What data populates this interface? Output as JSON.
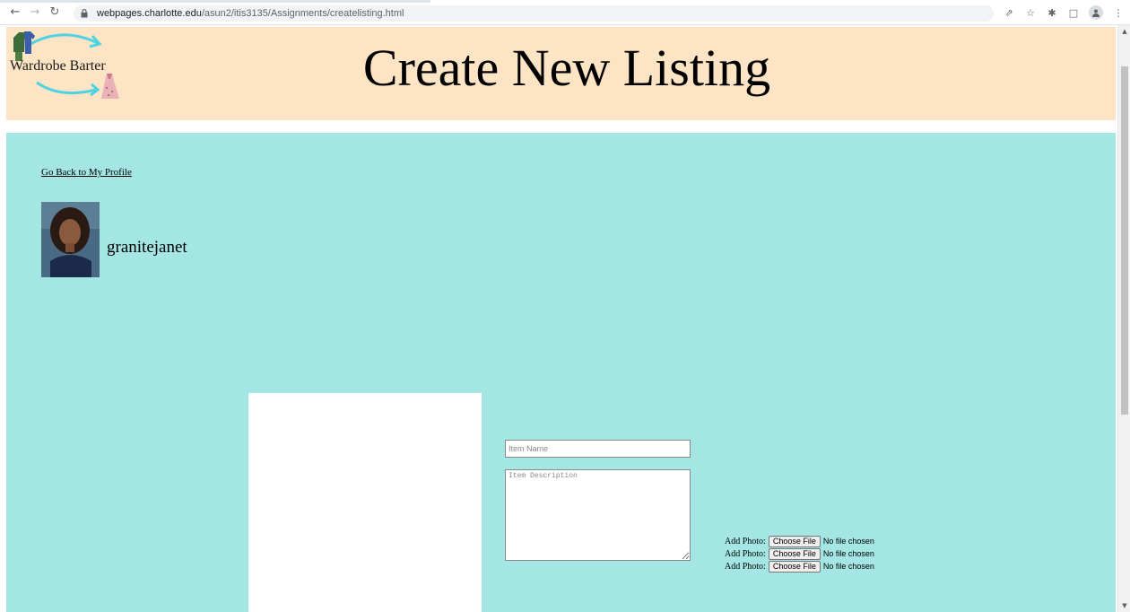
{
  "browser": {
    "url_host": "webpages.charlotte.edu",
    "url_path": "/asun2/itis3135/Assignments/createlisting.html",
    "icons": [
      "back-arrow-icon",
      "forward-arrow-icon",
      "reload-icon",
      "lock-icon",
      "share-icon",
      "star-icon",
      "extensions-icon",
      "side-panel-icon",
      "profile-icon",
      "more-icon"
    ]
  },
  "header": {
    "logo_text": "Wardrobe Barter",
    "title": "Create New Listing"
  },
  "profile": {
    "back_link": "Go Back to My Profile",
    "username": "granitejanet"
  },
  "form": {
    "item_name_placeholder": "Item Name",
    "item_description_placeholder": "Item Description",
    "photo_inputs": [
      {
        "label": "Add Photo:",
        "button": "Choose File",
        "status": "No file chosen"
      },
      {
        "label": "Add Photo:",
        "button": "Choose File",
        "status": "No file chosen"
      },
      {
        "label": "Add Photo:",
        "button": "Choose File",
        "status": "No file chosen"
      }
    ]
  },
  "colors": {
    "header_bg": "#fce4c4",
    "main_bg": "#a3e6e4",
    "arrow": "#4fd3e3"
  }
}
